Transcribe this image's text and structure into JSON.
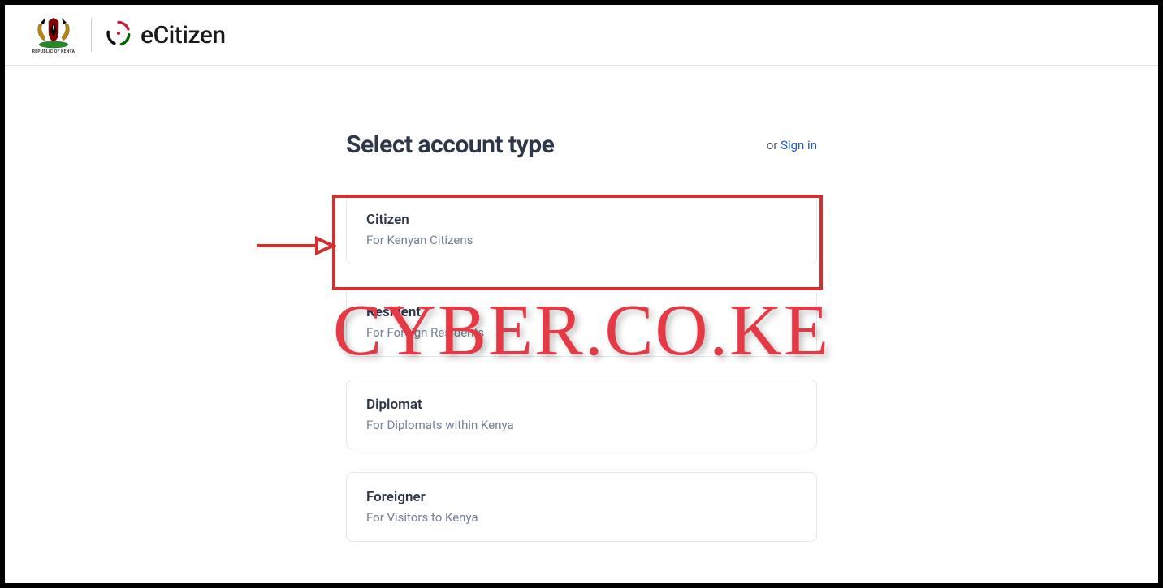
{
  "header": {
    "coat_label": "REPUBLIC OF KENYA",
    "brand_text": "eCitizen"
  },
  "page": {
    "title": "Select account type",
    "signin_prefix": "or ",
    "signin_link": "Sign in"
  },
  "account_types": [
    {
      "title": "Citizen",
      "subtitle": "For Kenyan Citizens"
    },
    {
      "title": "Resident",
      "subtitle": "For Foreign Residents"
    },
    {
      "title": "Diplomat",
      "subtitle": "For Diplomats within Kenya"
    },
    {
      "title": "Foreigner",
      "subtitle": "For Visitors to Kenya"
    }
  ],
  "watermark": "CYBER.CO.KE"
}
